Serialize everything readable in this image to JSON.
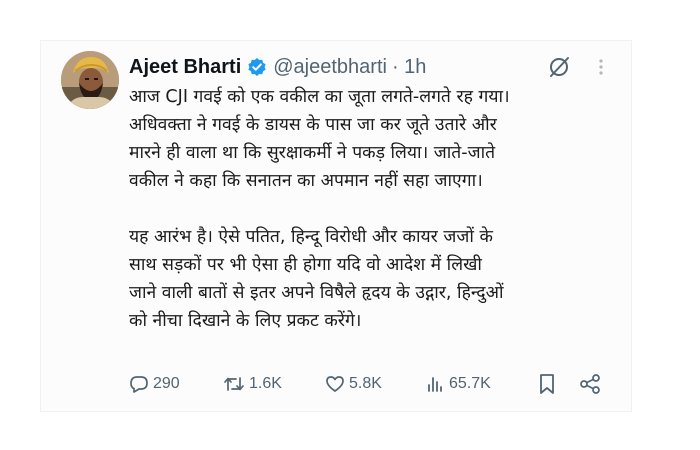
{
  "tweet": {
    "author": {
      "name": "Ajeet Bharti",
      "handle": "@ajeetbharti",
      "time": "· 1h",
      "verified": true
    },
    "body": {
      "para1": [
        "आज CJI गवई को एक वकील का जूता लगते-लगते रह गया।",
        "अधिवक्ता ने गवई के डायस के पास जा कर जूते उतारे और",
        "मारने ही वाला था कि सुरक्षाकर्मी ने पकड़ लिया। जाते-जाते",
        "वकील ने कहा कि सनातन का अपमान नहीं सहा जाएगा।"
      ],
      "para2": [
        "यह आरंभ है। ऐसे पतित, हिन्दू विरोधी और कायर जजों के",
        "साथ सड़कों पर भी ऐसा ही होगा यदि वो आदेश में लिखी",
        "जाने वाली बातों से इतर अपने विषैले हृदय के उद्गार, हिन्दुओं",
        "को नीचा दिखाने के लिए प्रकट करेंगे।"
      ]
    },
    "actions": {
      "replies": "290",
      "reposts": "1.6K",
      "likes": "5.8K",
      "views": "65.7K"
    },
    "icons": {
      "reply": "reply-icon",
      "repost": "repost-icon",
      "like": "like-icon",
      "views": "views-icon",
      "bookmark": "bookmark-icon",
      "share": "share-icon",
      "grok": "grok-icon",
      "more": "more-icon",
      "verified": "verified-badge-icon"
    },
    "colors": {
      "text": "#0f1419",
      "secondary": "#536471",
      "verified": "#1d9bf0"
    }
  }
}
